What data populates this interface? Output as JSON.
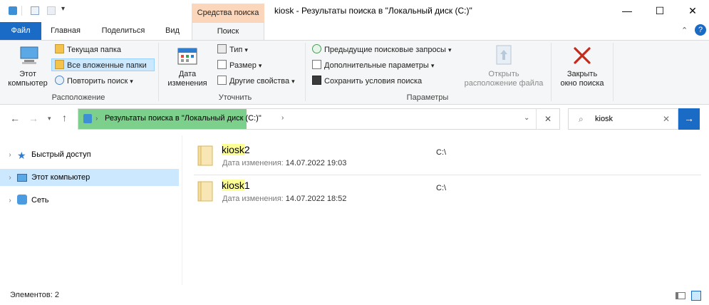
{
  "window": {
    "title": "kiosk - Результаты поиска в \"Локальный диск (C:)\"",
    "context_tab_group": "Средства поиска",
    "minimize": "—",
    "maximize": "☐",
    "close": "✕"
  },
  "tabs": [
    {
      "label": "Файл"
    },
    {
      "label": "Главная"
    },
    {
      "label": "Поделиться"
    },
    {
      "label": "Вид"
    },
    {
      "label": "Поиск"
    }
  ],
  "ribbon": {
    "groups": {
      "location": {
        "label": "Расположение",
        "this_pc_line1": "Этот",
        "this_pc_line2": "компьютер",
        "current_folder": "Текущая папка",
        "all_subfolders": "Все вложенные папки",
        "search_again": "Повторить поиск"
      },
      "refine": {
        "label": "Уточнить",
        "date_modified_line1": "Дата",
        "date_modified_line2": "изменения",
        "kind": "Тип",
        "size": "Размер",
        "other_properties": "Другие свойства"
      },
      "options": {
        "label": "Параметры",
        "recent_searches": "Предыдущие поисковые запросы",
        "advanced_options": "Дополнительные параметры",
        "save_search": "Сохранить условия поиска",
        "open_location_line1": "Открыть",
        "open_location_line2": "расположение файла"
      },
      "close": {
        "close_line1": "Закрыть",
        "close_line2": "окно поиска"
      }
    }
  },
  "address": {
    "text": "Результаты поиска в \"Локальный диск (C:)\"",
    "search_value": "kiosk"
  },
  "nav": [
    {
      "label": "Быстрый доступ"
    },
    {
      "label": "Этот компьютер"
    },
    {
      "label": "Сеть"
    }
  ],
  "results": [
    {
      "name_hl": "kiosk",
      "name_rest": "2",
      "meta_label": "Дата изменения:",
      "date": "14.07.2022 19:03",
      "path": "C:\\"
    },
    {
      "name_hl": "kiosk",
      "name_rest": "1",
      "meta_label": "Дата изменения:",
      "date": "14.07.2022 18:52",
      "path": "C:\\"
    }
  ],
  "status": {
    "items_count": "Элементов: 2"
  },
  "colors": {
    "accent": "#1a6bc5",
    "context_tab": "#fbd6ba",
    "progress": "#7dd08c",
    "selection": "#cce8ff",
    "highlight": "#fdfd96",
    "close_x": "#c42b1c"
  }
}
